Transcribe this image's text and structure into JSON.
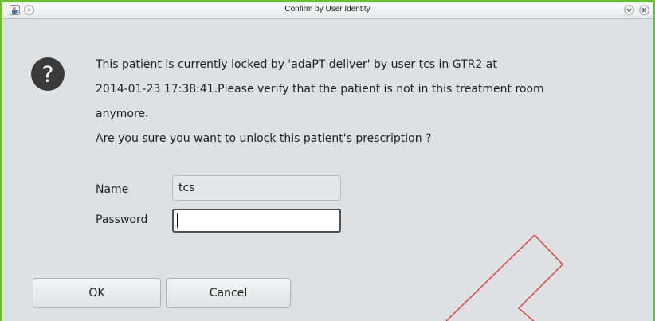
{
  "window": {
    "title": "Confirm by User Identity",
    "app_icon": "java-cup-icon",
    "controls": [
      "sticky-icon",
      "minimize-icon",
      "close-icon"
    ],
    "frame_color": "#6cbb3c"
  },
  "dialog": {
    "icon": "question-icon",
    "message_lines": [
      "This patient is currently locked by 'adaPT deliver' by user tcs in GTR2 at",
      "2014-01-23 17:38:41.Please verify that the patient is not in this treatment room",
      "anymore.",
      "Are you sure you want to unlock this patient's prescription ?"
    ]
  },
  "form": {
    "name_label": "Name",
    "name_value": "tcs",
    "password_label": "Password",
    "password_value": ""
  },
  "buttons": {
    "ok_label": "OK",
    "cancel_label": "Cancel"
  },
  "annotation": {
    "shape": "arrow",
    "color": "#e8383d"
  }
}
